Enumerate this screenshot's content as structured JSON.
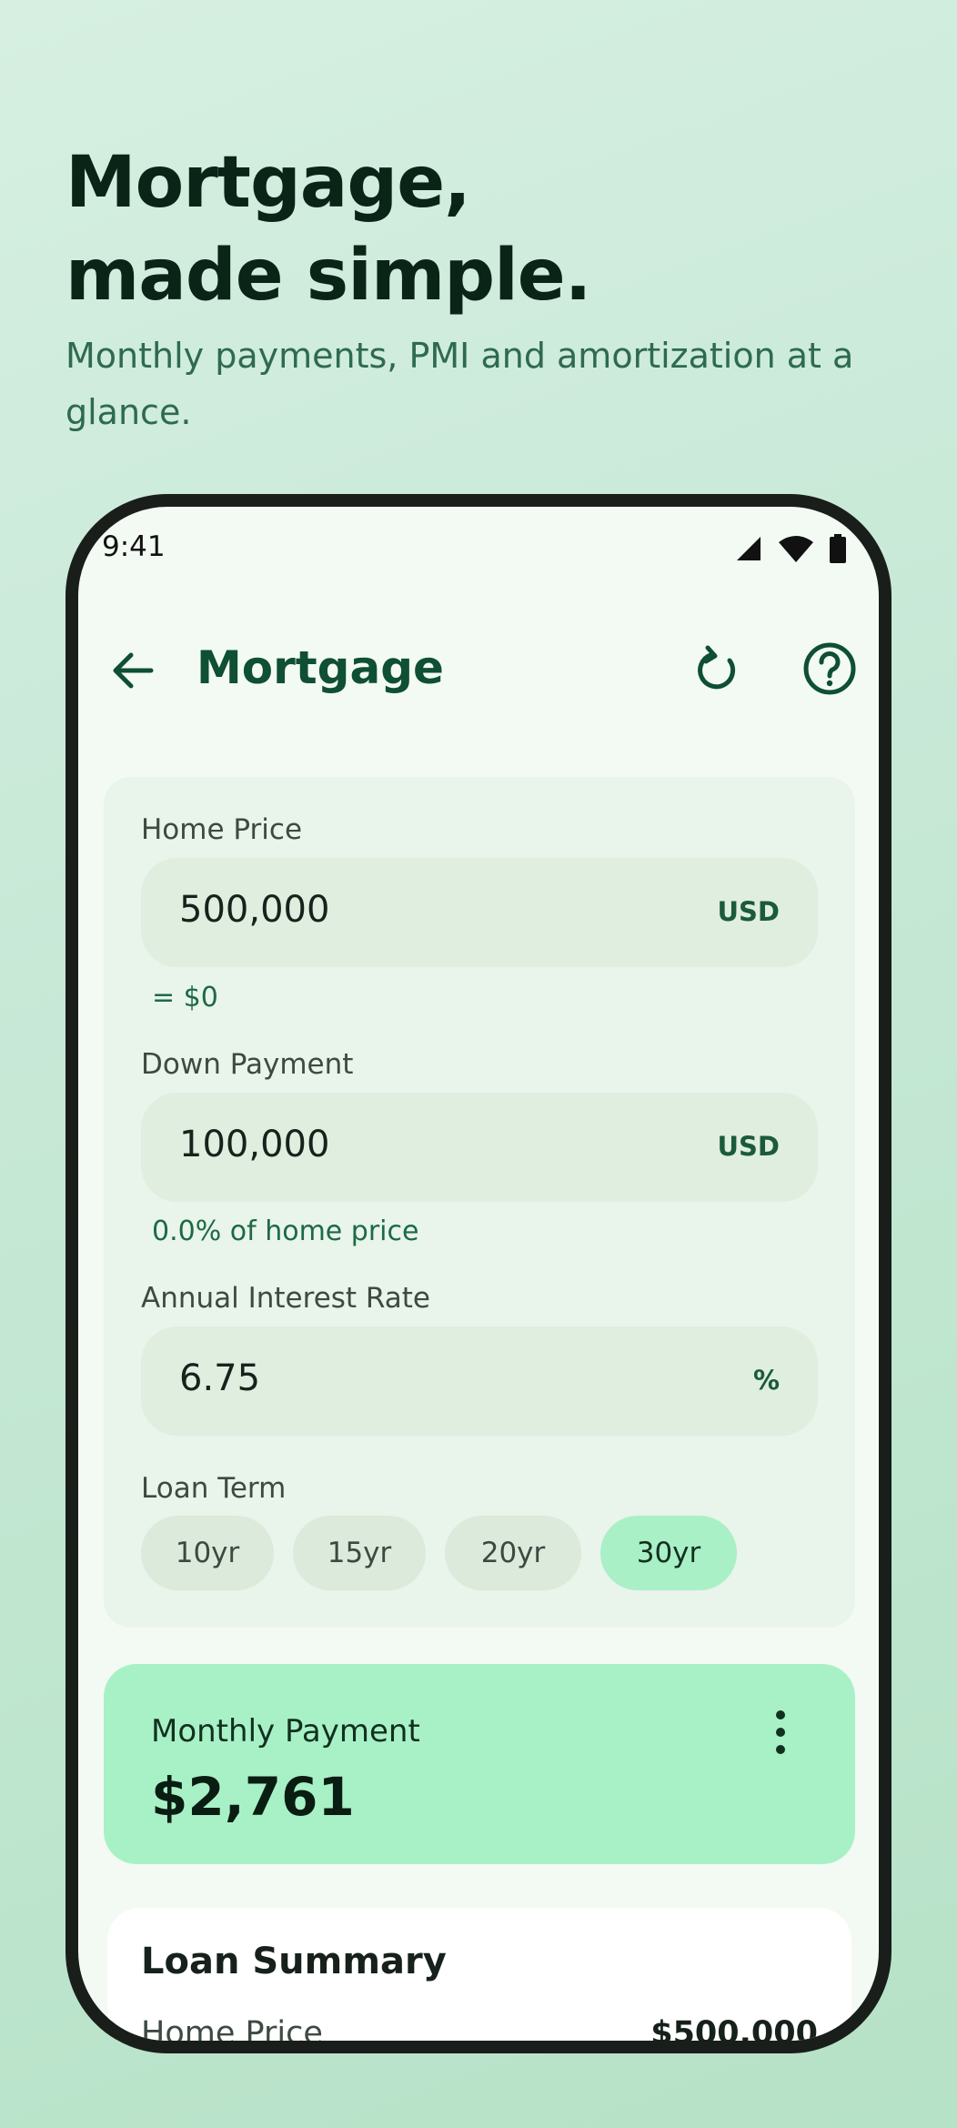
{
  "hero": {
    "title_line1": "Mortgage,",
    "title_line2": "made simple.",
    "subtitle": "Monthly payments, PMI and amortization at a glance."
  },
  "status_bar": {
    "time": "9:41",
    "icons": [
      "signal-icon",
      "wifi-icon",
      "battery-icon"
    ]
  },
  "app_bar": {
    "title": "Mortgage",
    "icons": [
      "back-arrow-icon",
      "refresh-icon",
      "help-icon"
    ]
  },
  "form": {
    "home_price": {
      "label": "Home Price",
      "value": "500,000",
      "unit": "USD",
      "helper": "= $0"
    },
    "down_payment": {
      "label": "Down Payment",
      "value": "100,000",
      "unit": "USD",
      "helper": "0.0% of home price"
    },
    "interest_rate": {
      "label": "Annual Interest Rate",
      "value": "6.75",
      "unit": "%"
    },
    "loan_term": {
      "label": "Loan Term",
      "options": [
        "10yr",
        "15yr",
        "20yr",
        "30yr"
      ],
      "selected": "30yr"
    }
  },
  "payment": {
    "label": "Monthly Payment",
    "value": "$2,761"
  },
  "summary": {
    "title": "Loan Summary",
    "rows": [
      {
        "label": "Home Price",
        "value": "$500,000"
      }
    ]
  },
  "colors": {
    "accent": "#0f4f33",
    "payment_card": "#a8f1c6",
    "selected_chip": "#a9f0c7"
  }
}
